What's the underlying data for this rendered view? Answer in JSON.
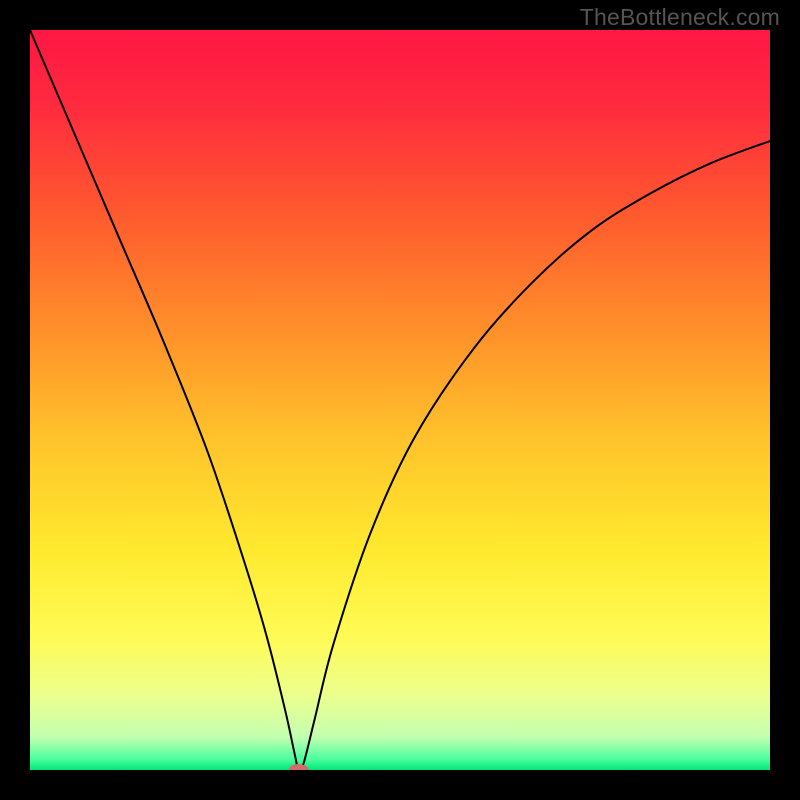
{
  "watermark": "TheBottleneck.com",
  "chart_data": {
    "type": "line",
    "title": "",
    "xlabel": "",
    "ylabel": "",
    "xlim": [
      0,
      100
    ],
    "ylim": [
      0,
      100
    ],
    "gradient_stops": [
      {
        "offset": 0,
        "color": "#ff1744"
      },
      {
        "offset": 0.1,
        "color": "#ff2a3f"
      },
      {
        "offset": 0.25,
        "color": "#ff5a2e"
      },
      {
        "offset": 0.4,
        "color": "#ff8e2a"
      },
      {
        "offset": 0.55,
        "color": "#ffc22b"
      },
      {
        "offset": 0.7,
        "color": "#ffe92e"
      },
      {
        "offset": 0.82,
        "color": "#fffb55"
      },
      {
        "offset": 0.9,
        "color": "#ecff8e"
      },
      {
        "offset": 0.955,
        "color": "#c4ffb0"
      },
      {
        "offset": 0.985,
        "color": "#4dffa0"
      },
      {
        "offset": 1.0,
        "color": "#00e676"
      }
    ],
    "series": [
      {
        "name": "bottleneck-curve",
        "x": [
          0,
          6,
          12,
          18,
          24,
          29,
          32,
          34.5,
          35.8,
          36.3,
          37,
          38.5,
          41,
          46,
          52,
          60,
          68,
          76,
          84,
          92,
          100
        ],
        "y": [
          100,
          86,
          72,
          58,
          43,
          28,
          18,
          8,
          2,
          0,
          1,
          7,
          17,
          32,
          45,
          57,
          66,
          73,
          78,
          82,
          85
        ]
      }
    ],
    "optimal_marker": {
      "x": 36.3,
      "y": 0,
      "color": "#d46a6a"
    },
    "curve_color": "#000000",
    "curve_width": 2
  }
}
